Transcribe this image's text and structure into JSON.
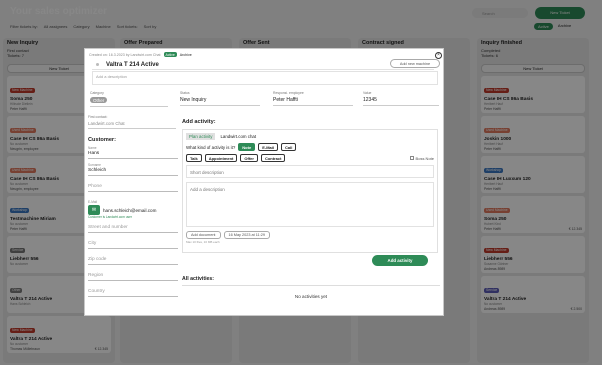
{
  "app": {
    "title": "Your sales optimizer",
    "search_placeholder": "Search",
    "new_ticket": "New Ticket"
  },
  "filters": [
    {
      "label": "Filter tickets by:",
      "value": "All assignees"
    },
    {
      "label": "Category",
      "value": ""
    },
    {
      "label": "Machine",
      "value": ""
    },
    {
      "label": "Sort tickets:",
      "value": "Sort by"
    }
  ],
  "view_toggle": {
    "active": "Active",
    "archive": "Archive"
  },
  "columns": [
    {
      "title": "New Inquiry",
      "sub": "First contact",
      "tickets": "Tickets: 7",
      "new_btn": "New Ticket",
      "cards": [
        {
          "badge": "New Machine",
          "badge_color": "#c0392b",
          "title": "Soma 250",
          "sub": "Hiltrude Dietlein",
          "person": "Peter Haffti",
          "price": ""
        },
        {
          "badge": "Used Machine",
          "badge_color": "#e07a5f",
          "title": "Case IH CS 86a Basis",
          "sub": "No customer",
          "person": "Neugrin, employee",
          "price": "€ 34.100"
        },
        {
          "badge": "Used Machine",
          "badge_color": "#e07a5f",
          "title": "Case IH CS 86a Basis",
          "sub": "No customer",
          "person": "Neugrin, employee",
          "price": ""
        },
        {
          "badge": "Workshop",
          "badge_color": "#3a78c2",
          "title": "Testmachine Miriam",
          "sub": "No customer",
          "person": "Peter Haffti",
          "price": ""
        },
        {
          "badge": "Service",
          "badge_color": "#777777",
          "title": "Liebherr 556",
          "sub": "No customer",
          "person": "",
          "price": ""
        },
        {
          "badge": "Other",
          "badge_color": "#7d7d7d",
          "title": "Valtra T 214 Active",
          "sub": "Hans Schleich",
          "person": "",
          "price": ""
        },
        {
          "badge": "New Machine",
          "badge_color": "#c0392b",
          "title": "Valtra T 214 Active",
          "sub": "No customer",
          "person": "Thomas Müllebraun",
          "price": "€ 12.345"
        }
      ]
    },
    {
      "title": "Offer Prepared",
      "sub": "",
      "tickets": "",
      "new_btn": "",
      "cards": []
    },
    {
      "title": "Offer Sent",
      "sub": "",
      "tickets": "",
      "new_btn": "",
      "cards": []
    },
    {
      "title": "Contract signed",
      "sub": "",
      "tickets": "",
      "new_btn": "",
      "cards": []
    },
    {
      "title": "Inquiry finished",
      "sub": "Completed",
      "tickets": "Tickets: 6",
      "new_btn": "New Ticket",
      "cards": [
        {
          "badge": "New Machine",
          "badge_color": "#c0392b",
          "title": "Case IH CS 86a Basis",
          "sub": "Heribert Hauf",
          "person": "Peter Haffti",
          "price": ""
        },
        {
          "badge": "Used Machine",
          "badge_color": "#e07a5f",
          "title": "Joskin 1000",
          "sub": "Heribert Hauf",
          "person": "Peter Haffti",
          "price": ""
        },
        {
          "badge": "Workshop",
          "badge_color": "#3a78c2",
          "title": "Case IH Luxxum 120",
          "sub": "Heribert Hauf",
          "person": "Peter Haffti",
          "price": ""
        },
        {
          "badge": "Used Machine",
          "badge_color": "#e07a5f",
          "title": "Soma 250",
          "sub": "Hubert Kind",
          "person": "Peter Haffti",
          "price": "€ 12.345"
        },
        {
          "badge": "New Machine",
          "badge_color": "#c0392b",
          "title": "Liebherr 556",
          "sub": "Susanne Gärtner",
          "person": "Andreas 8989",
          "price": ""
        },
        {
          "badge": "Service",
          "badge_color": "#5b5bb8",
          "title": "Valtra T 214 Active",
          "sub": "No customer",
          "person": "Andreas 8989",
          "price": "€ 2.500"
        }
      ]
    }
  ],
  "modal": {
    "created": "Created on: 16.3.2023 by Landwirt.com Chat",
    "status_badge": "Active",
    "archive_label": "Archive",
    "title": "Valtra T 214 Active",
    "add_machine": "Add new machine",
    "description_placeholder": "Add a description",
    "category_label": "Category",
    "category_value": "Other",
    "status_label": "Status",
    "status_value": "New Inquiry",
    "employee_label": "Responsi. employee",
    "employee_value": "Peter Haffti",
    "value_label": "Value",
    "value_value": "12345",
    "first_contact_label": "First contact:",
    "first_contact_value": "Landwirt.com Chat",
    "customer_head": "Customer:",
    "name_label": "Name",
    "name_value": "Hans",
    "surname_label": "Surname",
    "surname_value": "Schleich",
    "phone_placeholder": "Phone",
    "email_label": "E-Mail",
    "email_value": "hans.schleich@email.com",
    "customer_link": "Customer is Landwirt.com user",
    "street_placeholder": "Street and number",
    "city_placeholder": "City",
    "zip_placeholder": "Zip code",
    "region_placeholder": "Region",
    "country_placeholder": "Country",
    "activity_head": "Add activity:",
    "tab_plan": "Plan activity",
    "tab_chat": "Landwirt.com chat",
    "kind_question": "What kind of activity is it?",
    "kind_note": "Note",
    "kind_email": "E-Mail",
    "kind_call": "Call",
    "kind_talk": "Talk",
    "kind_appointment": "Appointment",
    "kind_offer": "Offer",
    "kind_contract": "Contract",
    "boss_note": "Boss Note",
    "short_desc_placeholder": "Short description",
    "add_desc_placeholder": "Add a description",
    "add_document": "Add document",
    "date_value": "16 May 2023 at 11:29",
    "doc_hint": "Max 10 files, 10 MB each",
    "add_activity_btn": "Add activity",
    "all_activities": "All activities:",
    "no_activities": "No activities yet"
  }
}
